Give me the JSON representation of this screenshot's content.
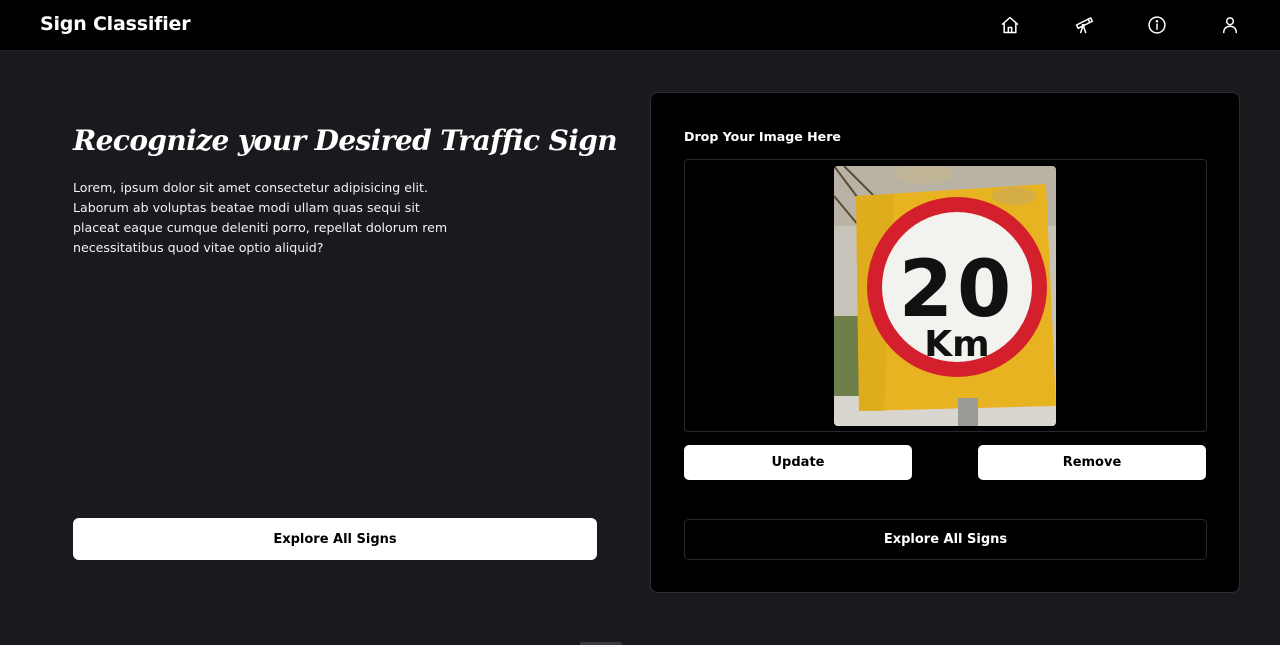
{
  "navbar": {
    "brand": "Sign Classifier",
    "icons": [
      "home-icon",
      "telescope-icon",
      "info-icon",
      "user-icon"
    ]
  },
  "hero": {
    "title": "Recognize your Desired Traffic Sign",
    "description": "Lorem, ipsum dolor sit amet consectetur adipisicing elit. Laborum ab voluptas beatae modi ullam quas sequi sit placeat eaque cumque deleniti porro, repellat dolorum rem necessitatibus quod vitae optio aliquid?",
    "explore_label": "Explore All Signs"
  },
  "upload_card": {
    "drop_label": "Drop Your Image Here",
    "preview_sign": {
      "number": "20",
      "unit": "Km"
    },
    "update_label": "Update",
    "remove_label": "Remove",
    "explore_label": "Explore All Signs"
  },
  "colors": {
    "page_bg": "#1a191e",
    "navbar_bg": "#000000",
    "card_bg": "#000000",
    "sign_red": "#d41f2c",
    "sign_yellow": "#e8b321"
  }
}
